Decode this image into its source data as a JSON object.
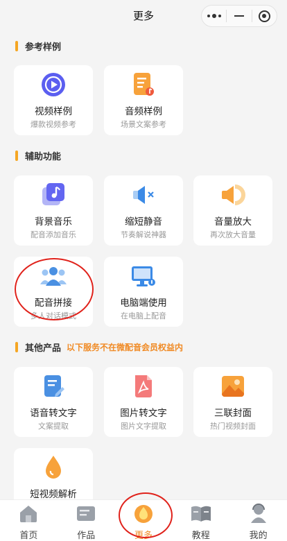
{
  "header": {
    "title": "更多"
  },
  "sections": {
    "reference": {
      "title": "参考样例"
    },
    "assist": {
      "title": "辅助功能"
    },
    "other": {
      "title": "其他产品",
      "note": "以下服务不在微配音会员权益内"
    }
  },
  "cards": {
    "video_sample": {
      "title": "视频样例",
      "subtitle": "爆款视频参考",
      "icon": "play-circle-icon"
    },
    "audio_sample": {
      "title": "音频样例",
      "subtitle": "场景文案参考",
      "icon": "audio-document-icon"
    },
    "bgm": {
      "title": "背景音乐",
      "subtitle": "配音添加音乐",
      "icon": "music-note-icon"
    },
    "trim_silence": {
      "title": "缩短静音",
      "subtitle": "节奏解说神器",
      "icon": "speaker-mute-icon"
    },
    "volume_up": {
      "title": "音量放大",
      "subtitle": "再次放大音量",
      "icon": "speaker-loud-icon"
    },
    "dub_join": {
      "title": "配音拼接",
      "subtitle": "多人对话模式",
      "icon": "group-icon"
    },
    "pc_use": {
      "title": "电脑端使用",
      "subtitle": "在电脑上配音",
      "icon": "monitor-icon"
    },
    "speech_to_text": {
      "title": "语音转文字",
      "subtitle": "文案提取",
      "icon": "document-edit-icon"
    },
    "image_to_text": {
      "title": "图片转文字",
      "subtitle": "图片文字提取",
      "icon": "pdf-document-icon"
    },
    "cover": {
      "title": "三联封面",
      "subtitle": "热门视频封面",
      "icon": "image-icon"
    },
    "video_parse": {
      "title": "短视频解析",
      "subtitle": "",
      "icon": "droplet-icon"
    }
  },
  "tabbar": {
    "home": "首页",
    "works": "作品",
    "more": "更多",
    "tutorial": "教程",
    "mine": "我的"
  },
  "colors": {
    "accent": "#f5a623",
    "note": "#f08a24",
    "annotation": "#e0221b"
  }
}
